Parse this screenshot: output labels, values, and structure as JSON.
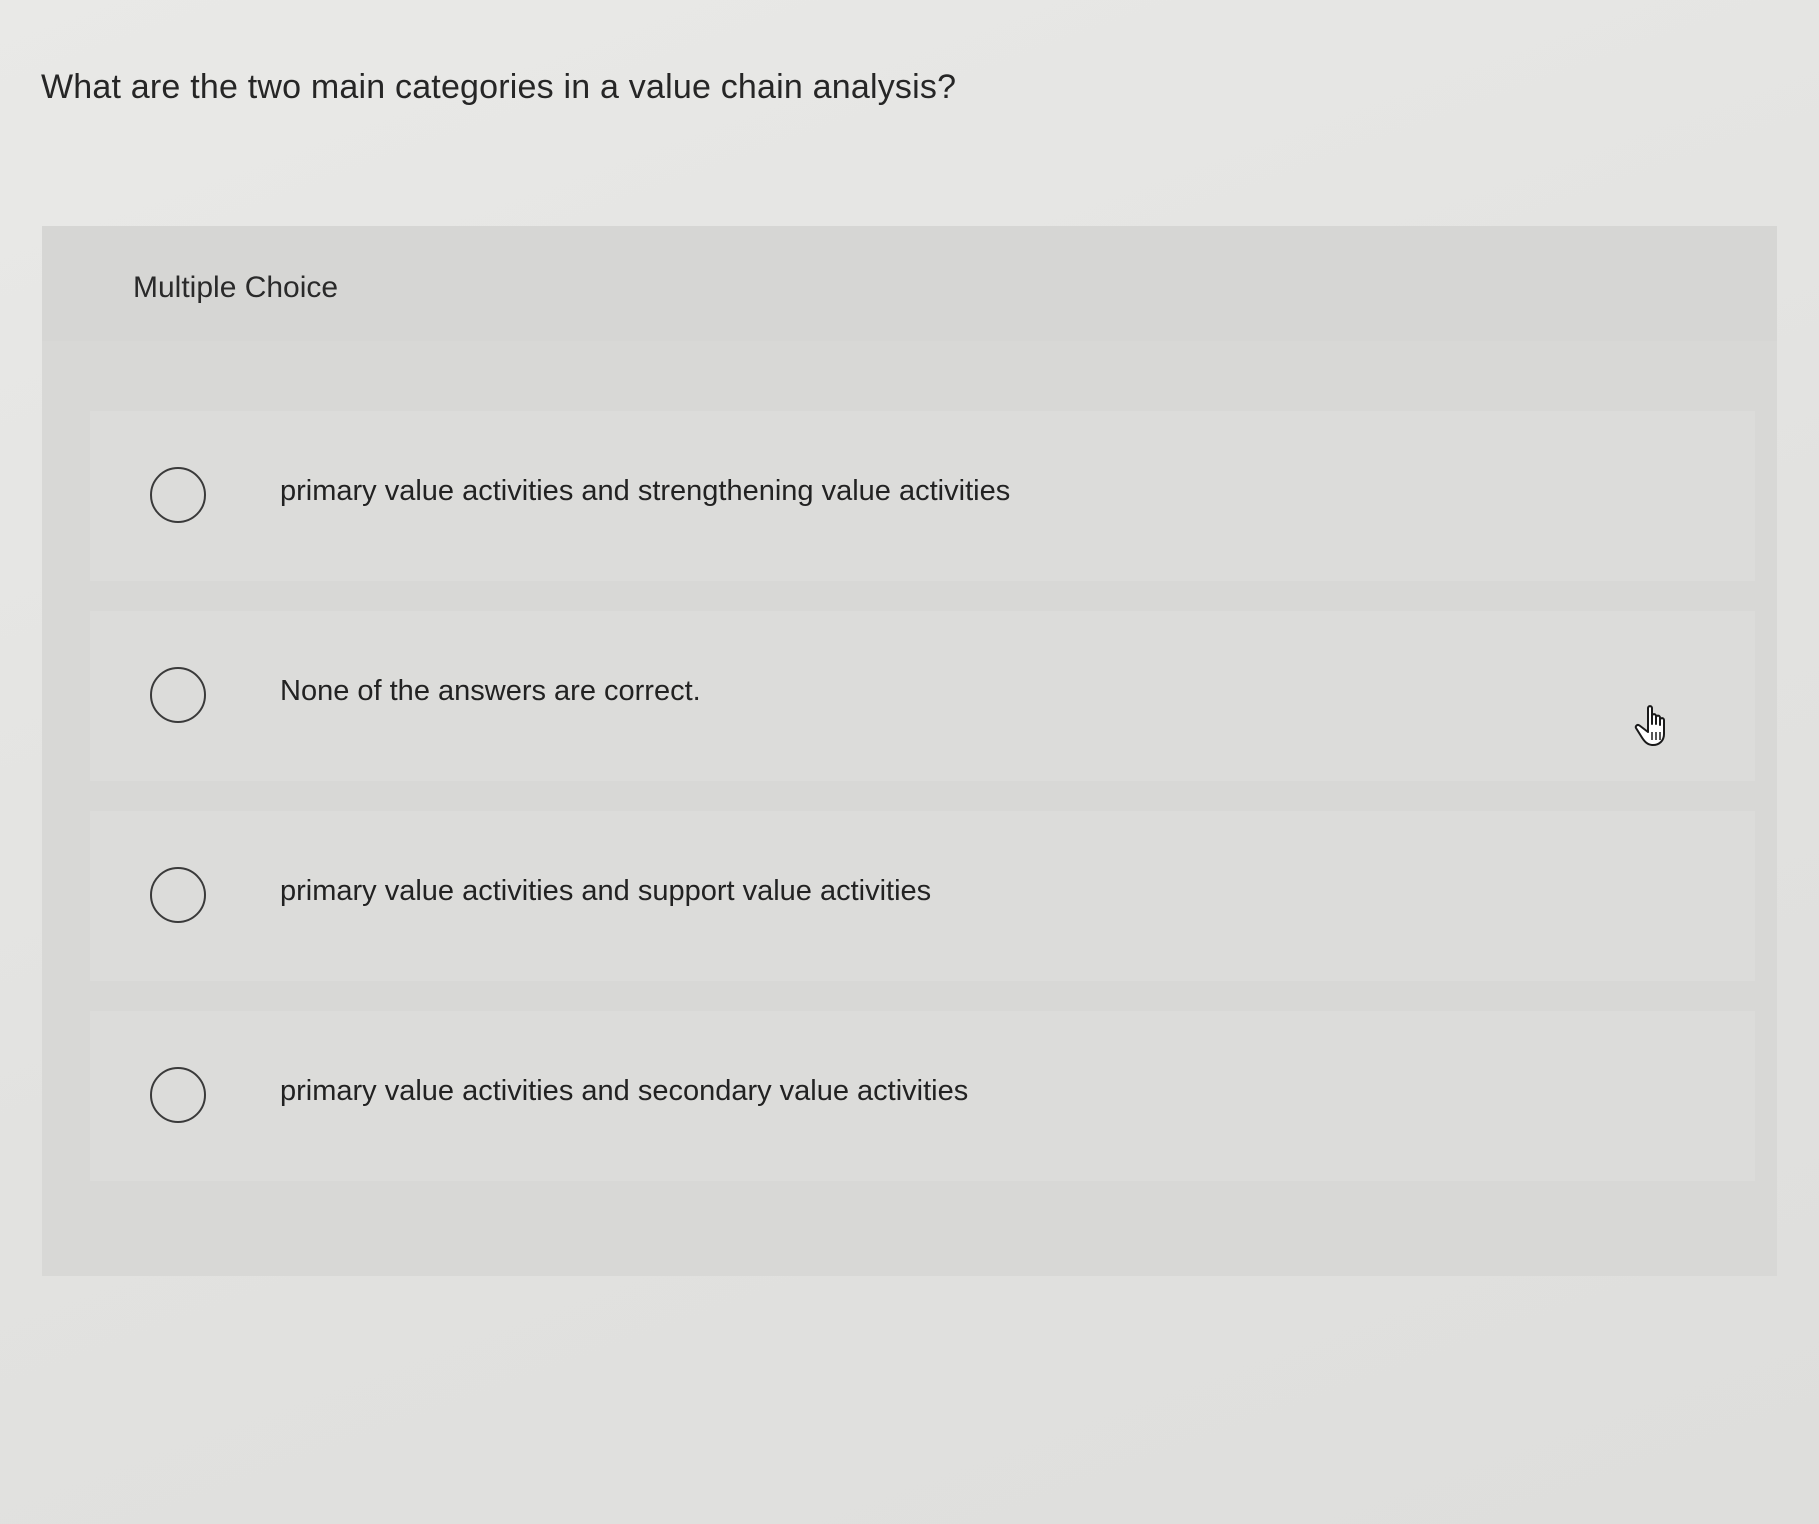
{
  "question": {
    "text": "What are the two main categories in a value chain analysis?"
  },
  "panel": {
    "label": "Multiple Choice",
    "options": [
      {
        "text": "primary value activities and strengthening value activities",
        "selected": false
      },
      {
        "text": "None of the answers are correct.",
        "selected": false
      },
      {
        "text": "primary value activities and support value activities",
        "selected": false
      },
      {
        "text": "primary value activities and secondary value activities",
        "selected": false
      }
    ]
  },
  "cursor": {
    "icon": "pointer-hand-icon"
  }
}
